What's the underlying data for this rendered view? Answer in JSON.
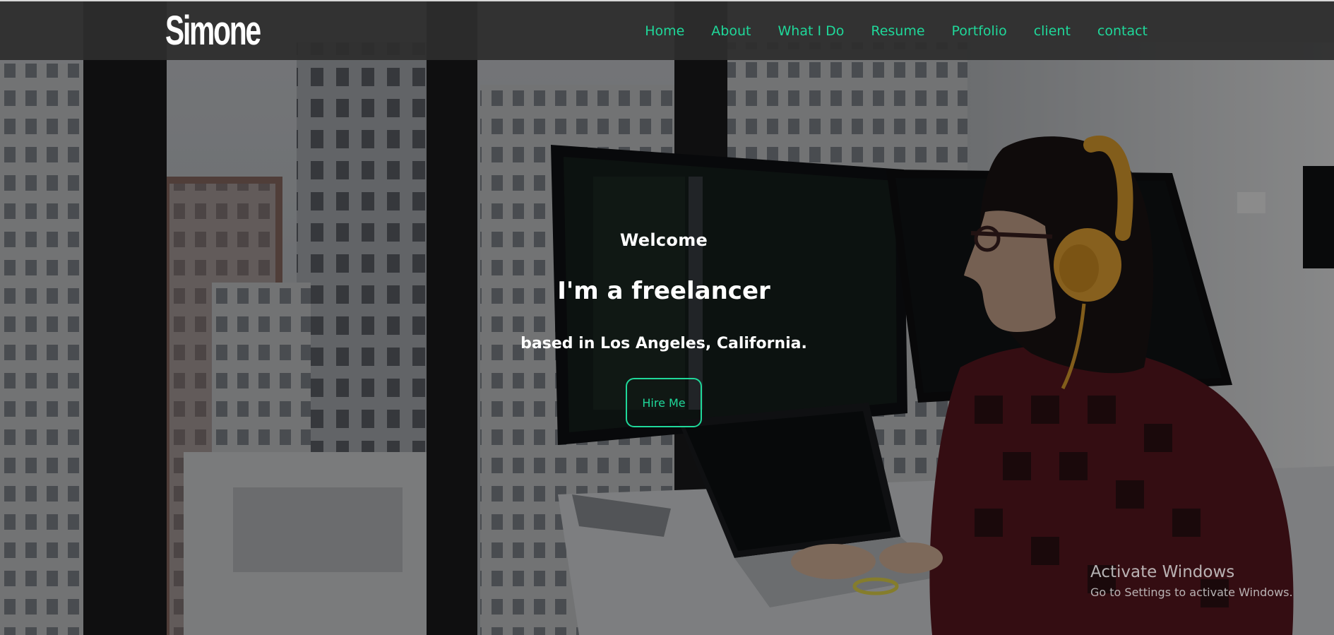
{
  "brand": {
    "logo_text": "Simone",
    "accent_color": "#1fd89a"
  },
  "nav": {
    "items": [
      {
        "label": "Home"
      },
      {
        "label": "About"
      },
      {
        "label": "What I Do"
      },
      {
        "label": "Resume"
      },
      {
        "label": "Portfolio"
      },
      {
        "label": "client"
      },
      {
        "label": "contact"
      }
    ]
  },
  "hero": {
    "welcome": "Welcome",
    "title": "I'm a freelancer",
    "subtitle": "based in Los Angeles, California.",
    "cta_label": "Hire Me"
  },
  "watermark": {
    "title": "Activate Windows",
    "subtitle": "Go to Settings to activate Windows."
  }
}
